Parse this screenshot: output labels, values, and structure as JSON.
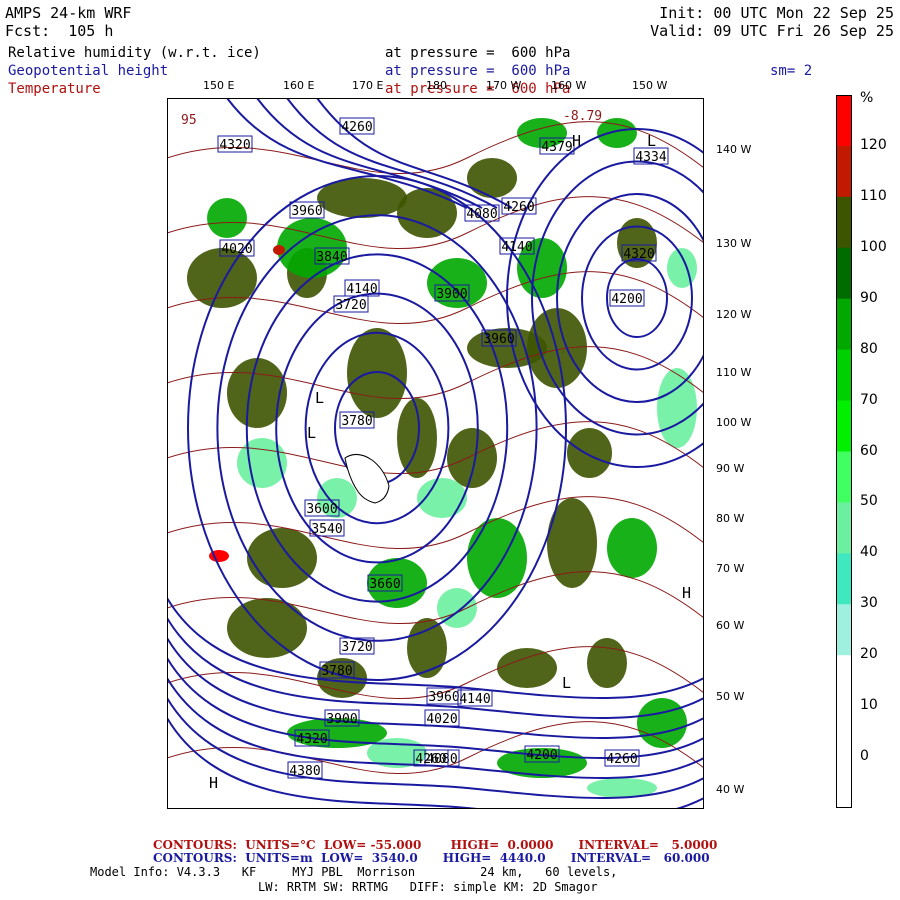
{
  "header": {
    "model": "AMPS 24-km WRF",
    "fcst": "Fcst:  105 h",
    "init": "Init: 00 UTC Mon 22 Sep 25",
    "valid": "Valid: 09 UTC Fri 26 Sep 25",
    "sm": "sm= 2"
  },
  "fields": [
    {
      "name": "Relative humidity (w.r.t. ice)",
      "level": "at pressure =  600 hPa",
      "color": "#000000"
    },
    {
      "name": "Geopotential height",
      "level": "at pressure =  600 hPa",
      "color": "#1a1aa0"
    },
    {
      "name": "Temperature",
      "level": "at pressure =  600 hPa",
      "color": "#b01010"
    }
  ],
  "map": {
    "lon_labels": [
      "150 E",
      "160 E",
      "170 E",
      "180",
      "170 W",
      "160 W",
      "150 W"
    ],
    "lat_labels": [
      "140 W",
      "130 W",
      "120 W",
      "110 W",
      "100 W",
      "90 W",
      "80 W",
      "70 W",
      "60 W",
      "50 W",
      "40 W"
    ],
    "height_labels": [
      "4260",
      "4320",
      "4379",
      "4334",
      "4320",
      "4200",
      "4140",
      "4080",
      "3960",
      "4260",
      "4020",
      "3840",
      "4140",
      "3720",
      "3900",
      "3960",
      "3780",
      "3600",
      "3540",
      "3660",
      "3720",
      "3780",
      "3900",
      "3960",
      "4020",
      "4140",
      "4080",
      "4200",
      "4260",
      "4320",
      "4380",
      "4260"
    ],
    "temp_labels": [
      "95",
      "-8.79"
    ],
    "center_marks": [
      "H",
      "L",
      "H",
      "L",
      "L",
      "H",
      "L"
    ],
    "colors": {
      "height_contour": "#1a1aa0",
      "temp_contour": "#8b1a1a",
      "coast": "#8b2020",
      "land_hole": "#ffffff"
    }
  },
  "colorbar": {
    "unit": "%",
    "ticks": [
      "120",
      "110",
      "100",
      "90",
      "80",
      "70",
      "60",
      "50",
      "40",
      "30",
      "20",
      "10",
      "0"
    ],
    "colors": [
      "#ff0000",
      "#c01a00",
      "#3d5400",
      "#006c00",
      "#00a800",
      "#00d000",
      "#00f000",
      "#40ff60",
      "#6cf0a0",
      "#40e8c0",
      "#a0f0e0",
      "#ffffff",
      "#ffffff",
      "#ffffff"
    ]
  },
  "footer": {
    "temp_contours": "CONTOURS:  UNITS=°C  LOW= -55.000       HIGH=  0.0000      INTERVAL=   5.0000",
    "height_contours": "CONTOURS:  UNITS=m  LOW=  3540.0      HIGH=  4440.0      INTERVAL=   60.000",
    "model_info1": "Model Info: V4.3.3   KF     MYJ PBL  Morrison         24 km,   60 levels,",
    "model_info2": "LW: RRTM SW: RRTMG   DIFF: simple KM: 2D Smagor"
  }
}
